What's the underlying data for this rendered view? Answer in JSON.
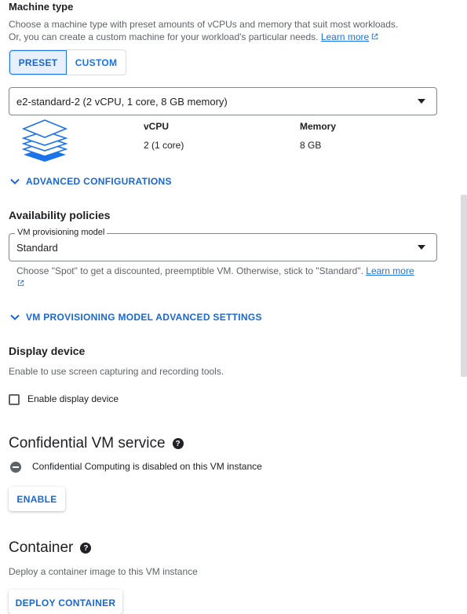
{
  "machine_type": {
    "title": "Machine type",
    "desc_line1": "Choose a machine type with preset amounts of vCPUs and memory that suit most workloads.",
    "desc_line2": "Or, you can create a custom machine for your workload's particular needs.",
    "learn_more": "Learn more",
    "tabs": {
      "preset": "PRESET",
      "custom": "CUSTOM",
      "selected": "preset"
    },
    "select_value": "e2-standard-2 (2 vCPU, 1 core, 8 GB memory)",
    "specs": {
      "vcpu_label": "vCPU",
      "vcpu_value": "2 (1 core)",
      "memory_label": "Memory",
      "memory_value": "8 GB"
    },
    "advanced_configurations": "ADVANCED CONFIGURATIONS"
  },
  "availability": {
    "title": "Availability policies",
    "provisioning_label": "VM provisioning model",
    "provisioning_value": "Standard",
    "hint": "Choose \"Spot\" to get a discounted, preemptible VM. Otherwise, stick to \"Standard\".",
    "learn_more": "Learn more",
    "advanced_settings": "VM PROVISIONING MODEL ADVANCED SETTINGS"
  },
  "display_device": {
    "title": "Display device",
    "desc": "Enable to use screen capturing and recording tools.",
    "checkbox_label": "Enable display device",
    "checked": false
  },
  "confidential": {
    "title": "Confidential VM service",
    "status": "Confidential Computing is disabled on this VM instance",
    "enable_button": "ENABLE"
  },
  "container": {
    "title": "Container",
    "desc": "Deploy a container image to this VM instance",
    "deploy_button": "DEPLOY CONTAINER"
  },
  "colors": {
    "accent": "#1a73e8",
    "accent_dark": "#1967d2",
    "text": "#202124",
    "muted": "#5f6368",
    "border": "#80868b"
  },
  "icons": [
    "external-link-icon",
    "machine-stack-icon",
    "chevron-down-icon",
    "help-icon",
    "remove-circle-icon"
  ]
}
